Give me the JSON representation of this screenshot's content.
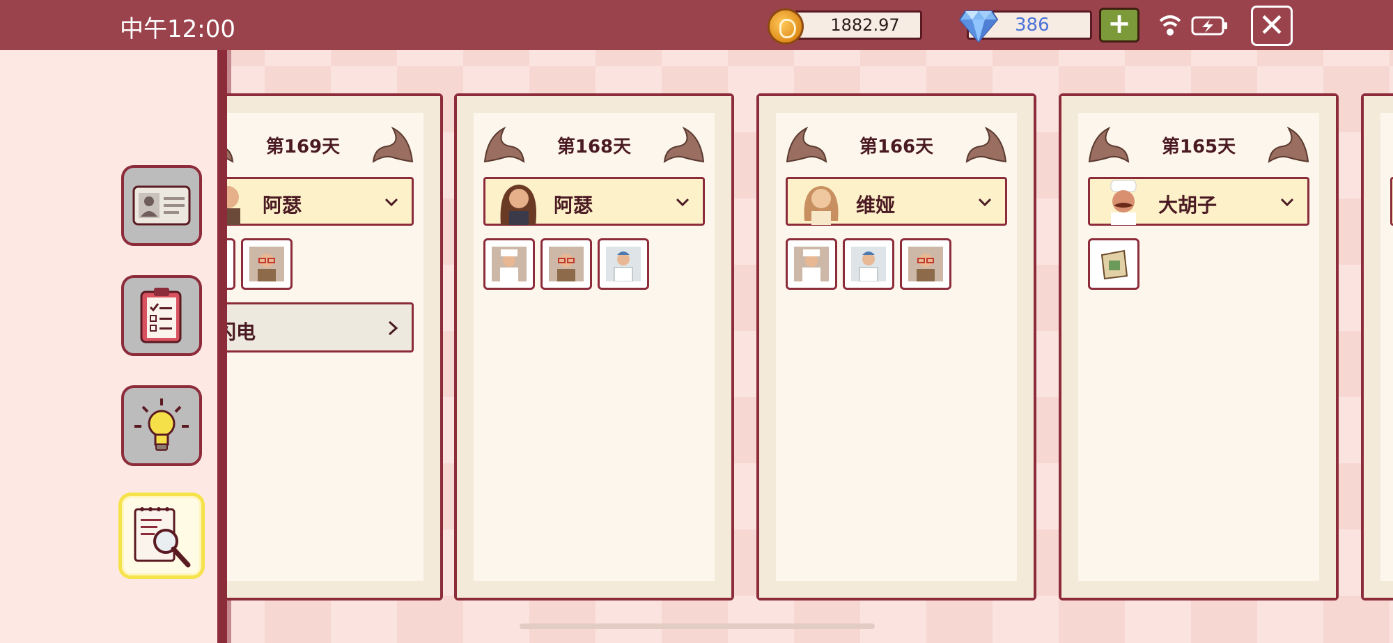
{
  "status_bar": {
    "time": "中午12:00",
    "coins": "1882.97",
    "gems": "386",
    "add_label": "+",
    "close_label": "✕"
  },
  "sidebar": {
    "buttons": [
      {
        "icon": "id-card-icon"
      },
      {
        "icon": "clipboard-icon"
      },
      {
        "icon": "lightbulb-icon"
      },
      {
        "icon": "notebook-search-icon",
        "active": true
      }
    ]
  },
  "cards": [
    {
      "day": "第169天",
      "customer": "阿瑟",
      "portrait": "man-portrait",
      "chips": [
        "chef",
        "glasses-chef"
      ],
      "extra": "闪电"
    },
    {
      "day": "第168天",
      "customer": "阿瑟",
      "portrait": "long-hair-man",
      "chips": [
        "chef",
        "glasses-chef",
        "doctor"
      ]
    },
    {
      "day": "第166天",
      "customer": "维娅",
      "portrait": "woman",
      "chips": [
        "chef",
        "doctor",
        "glasses-chef"
      ]
    },
    {
      "day": "第165天",
      "customer": "大胡子",
      "portrait": "mustache-chef",
      "chips": [
        "tea-bag"
      ]
    }
  ]
}
